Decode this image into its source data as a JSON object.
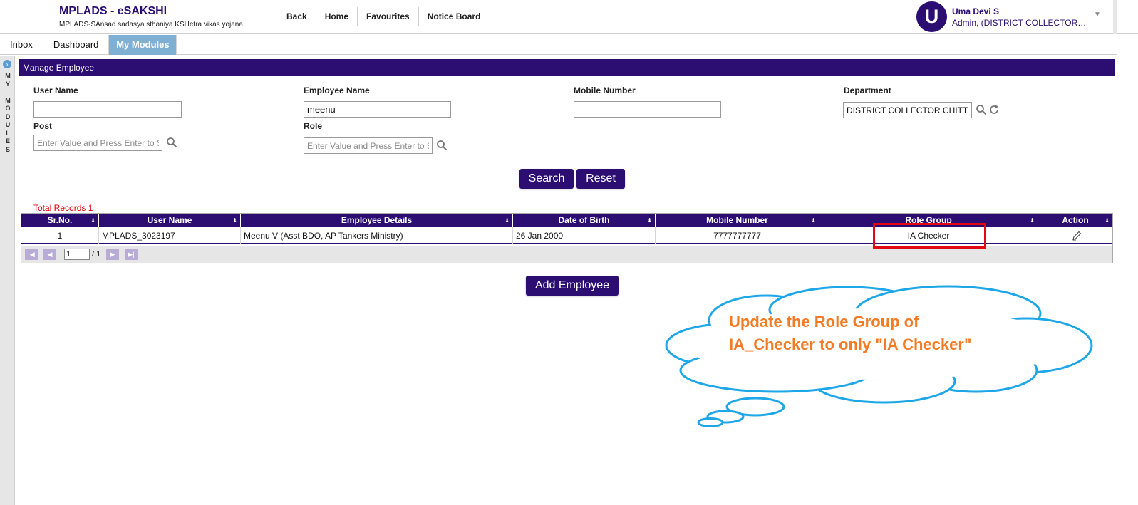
{
  "header": {
    "title": "MPLADS - eSAKSHI",
    "subtitle": "MPLADS-SAnsad sadasya sthaniya KSHetra vikas yojana",
    "nav": [
      "Back",
      "Home",
      "Favourites",
      "Notice Board"
    ],
    "user": {
      "initial": "U",
      "name": "Uma Devi S",
      "role": "Admin, (DISTRICT COLLECTOR…",
      "dropdown_glyph": "▼"
    }
  },
  "tabs": [
    "Inbox",
    "Dashboard",
    "My Modules"
  ],
  "active_tab": "My Modules",
  "side_rail": {
    "text": "MY MODULES",
    "letters": [
      "M",
      "Y",
      "",
      "M",
      "O",
      "D",
      "U",
      "L",
      "E",
      "S"
    ]
  },
  "panel": {
    "title": "Manage Employee"
  },
  "form": {
    "user_name": {
      "label": "User Name",
      "value": ""
    },
    "employee_name": {
      "label": "Employee Name",
      "value": "meenu"
    },
    "mobile_number": {
      "label": "Mobile Number",
      "value": ""
    },
    "department": {
      "label": "Department",
      "value": "DISTRICT COLLECTOR CHITTO"
    },
    "post": {
      "label": "Post",
      "placeholder": "Enter Value and Press Enter to S"
    },
    "role": {
      "label": "Role",
      "placeholder": "Enter Value and Press Enter to S"
    }
  },
  "buttons": {
    "search": "Search",
    "reset": "Reset",
    "add_employee": "Add Employee"
  },
  "total_records": "Total Records 1",
  "grid": {
    "columns": [
      "Sr.No.",
      "User Name",
      "Employee Details",
      "Date of Birth",
      "Mobile Number",
      "Role Group",
      "Action"
    ],
    "sort_glyph": "⬍",
    "rows": [
      {
        "sr_no": "1",
        "user_name": "MPLADS_3023197",
        "employee_details": "Meenu V (Asst BDO, AP Tankers Ministry)",
        "dob": "26 Jan 2000",
        "mobile": "7777777777",
        "role_group": "IA Checker",
        "action_icon": "edit-icon"
      }
    ],
    "pager": {
      "current_page": "1",
      "total_pages": "/ 1"
    }
  },
  "callout": {
    "line1": "Update the Role Group of",
    "line2": "IA_Checker to only \"IA Checker\""
  },
  "colors": {
    "brand": "#2c0e73",
    "active_tab": "#7fb0d4",
    "highlight_box": "#e30613",
    "callout_text": "#f47a23",
    "cloud_stroke": "#1ea7e8",
    "total_records": "#e60000"
  }
}
